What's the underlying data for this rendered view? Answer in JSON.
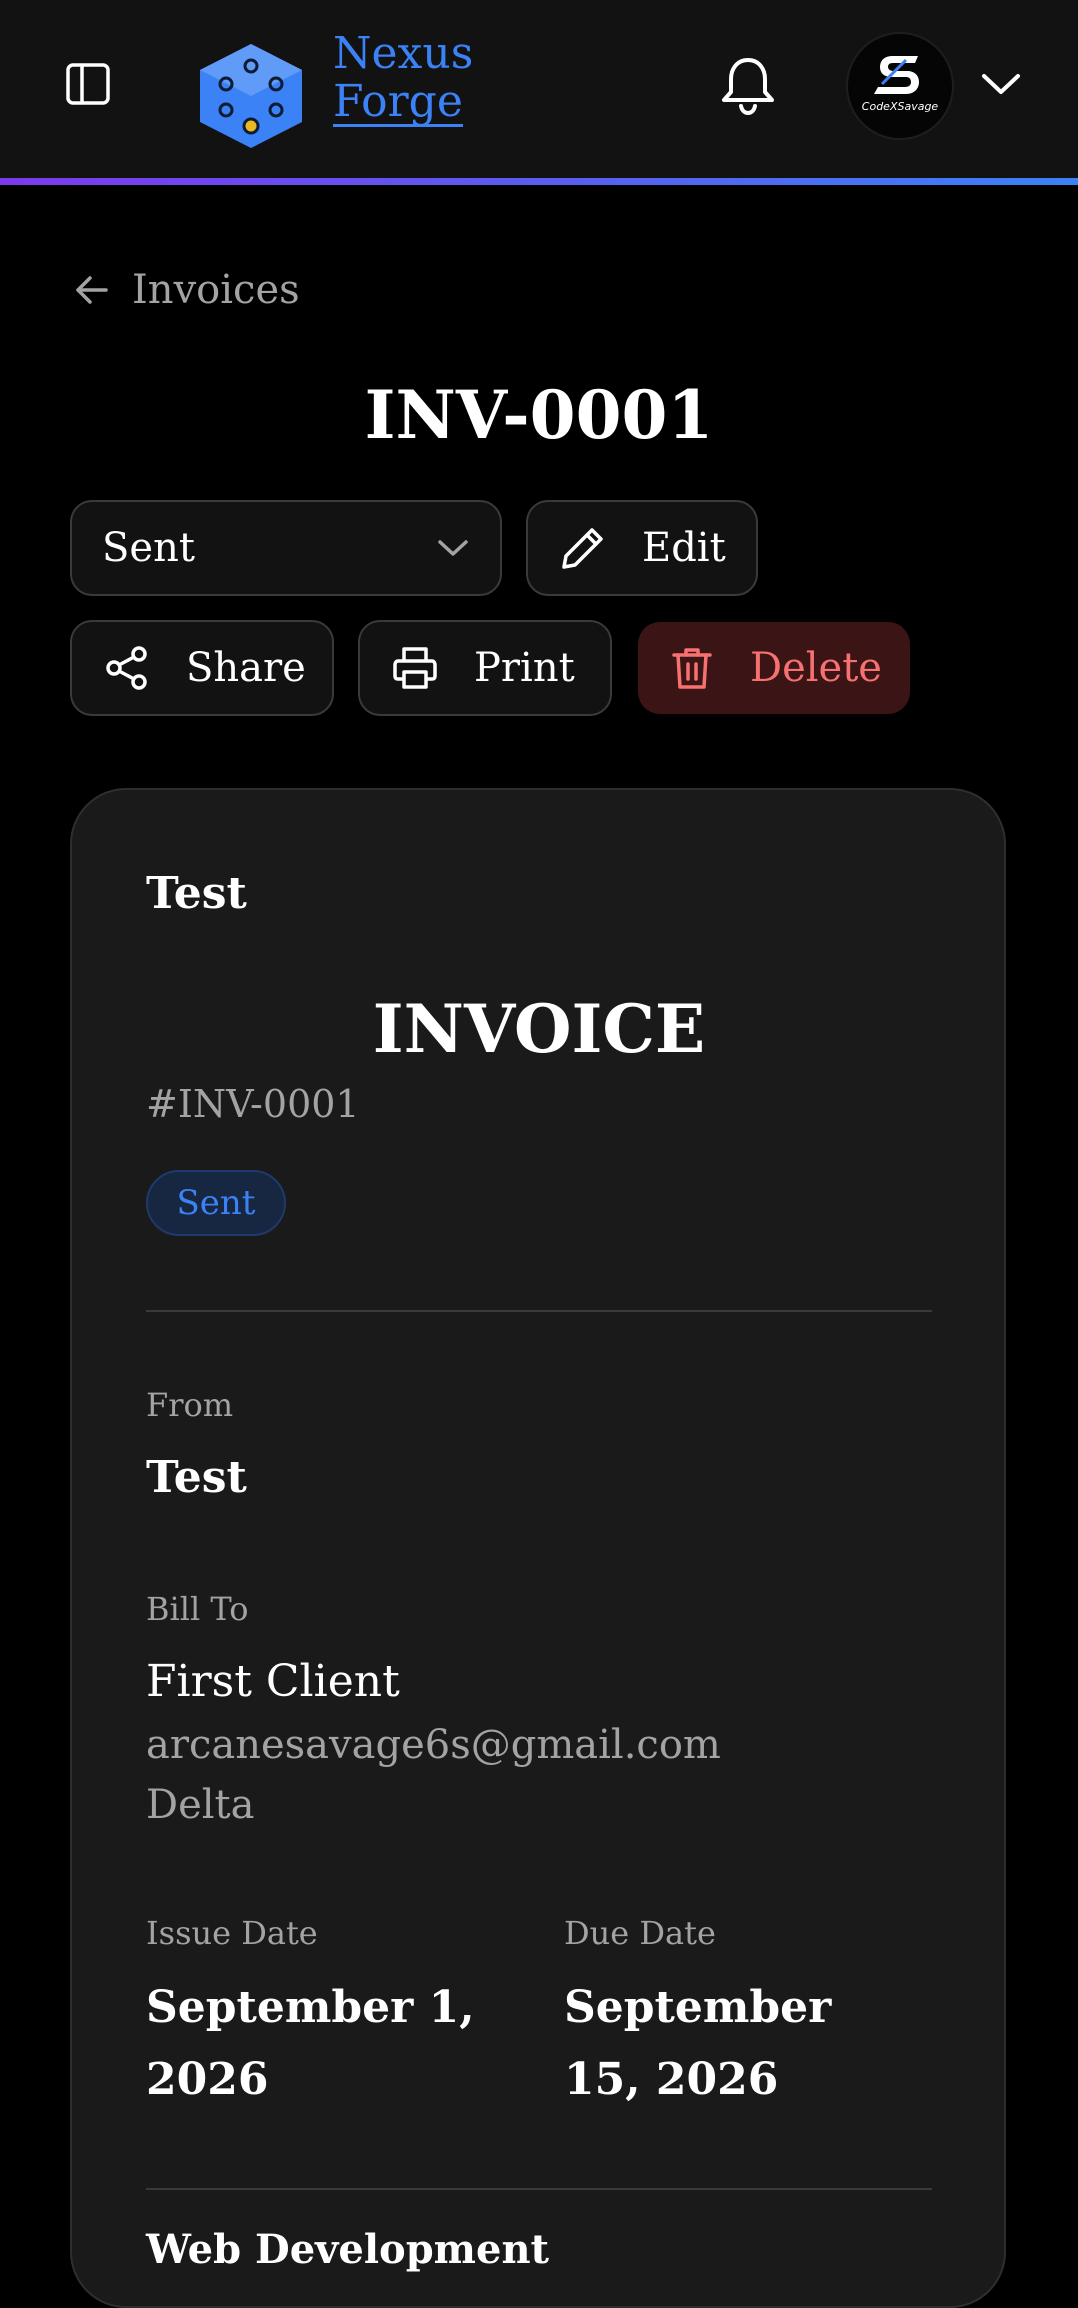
{
  "header": {
    "brand_line1": "Nexus",
    "brand_line2": "Forge",
    "avatar_text": "CodeXSavage",
    "accent_color": "#3b82f6",
    "gradient_colors": [
      "#7c3aed",
      "#3b82f6"
    ]
  },
  "nav": {
    "back_label": "Invoices"
  },
  "page": {
    "title": "INV-0001"
  },
  "actions": {
    "status_value": "Sent",
    "edit_label": "Edit",
    "share_label": "Share",
    "print_label": "Print",
    "delete_label": "Delete"
  },
  "invoice": {
    "business_name": "Test",
    "heading": "INVOICE",
    "number": "#INV-0001",
    "status": "Sent",
    "from_label": "From",
    "from_name": "Test",
    "bill_to_label": "Bill To",
    "client_name": "First Client",
    "client_email": "arcanesavage6s@gmail.com",
    "client_location": "Delta",
    "issue_date_label": "Issue Date",
    "issue_date": "September 1, 2026",
    "due_date_label": "Due Date",
    "due_date": "September 15, 2026",
    "first_item": "Web Development"
  },
  "icons": [
    "sidebar-toggle-icon",
    "logo-icon",
    "bell-icon",
    "chevron-down-icon",
    "arrow-left-icon",
    "pencil-icon",
    "share-icon",
    "printer-icon",
    "trash-icon"
  ],
  "colors": {
    "danger": "#f87171",
    "danger_bg": "#3b1416",
    "badge_bg": "#172742"
  }
}
